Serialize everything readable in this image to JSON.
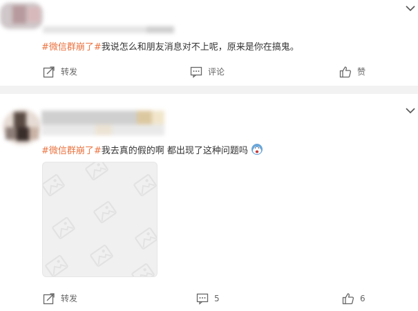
{
  "post1": {
    "text_hashtag": "#微信群崩了#",
    "text_body": "我说怎么和朋友消息对不上呢，原来是你在搞鬼。",
    "actions": {
      "repost_label": "转发",
      "comment_label": "评论",
      "like_label": "赞"
    }
  },
  "post2": {
    "text_hashtag": "#微信群崩了#",
    "text_body": "我去真的假的啊 都出现了这种问题吗",
    "emoji_icon": "scared-face-emoji",
    "image_icon": "image-placeholder-icon",
    "actions": {
      "repost_label": "转发",
      "comment_count": "5",
      "like_count": "6"
    }
  },
  "colors": {
    "hashtag": "#eb7340",
    "separator": "#f2f2f2",
    "action_text": "#666666"
  }
}
